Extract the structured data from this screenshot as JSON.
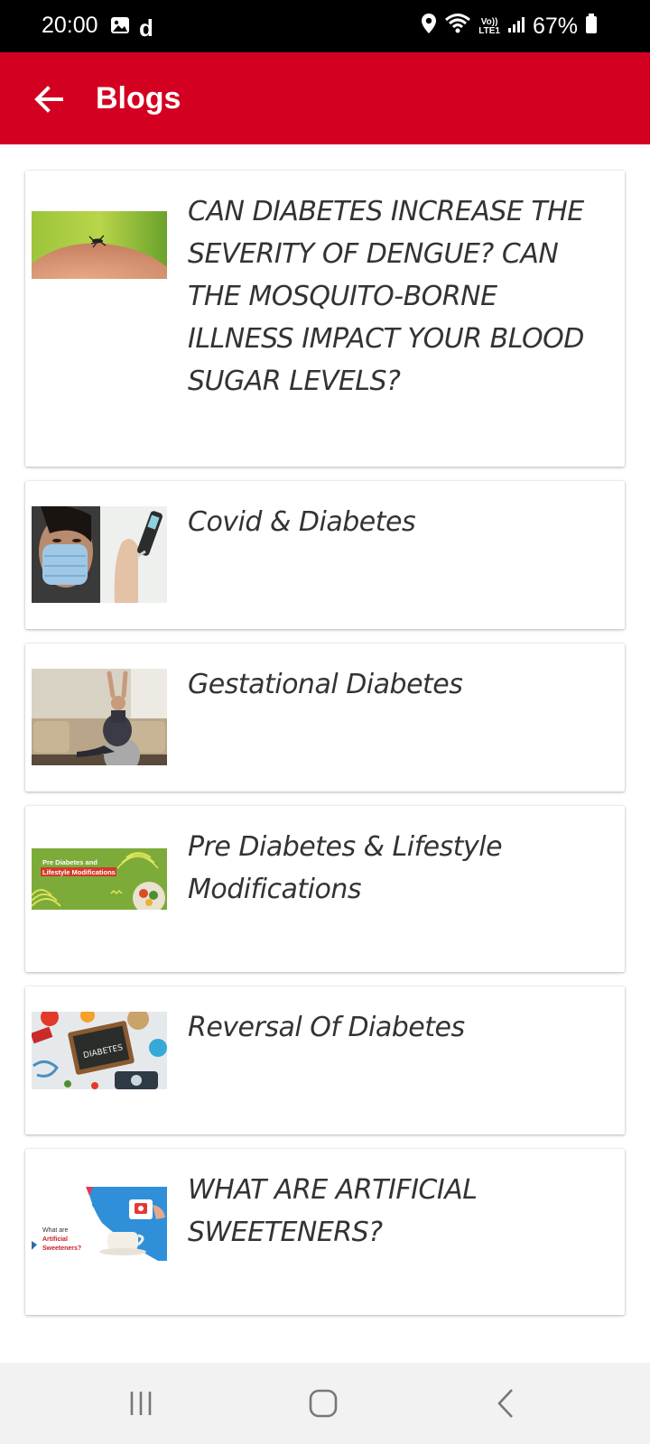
{
  "status_bar": {
    "time": "20:00",
    "carrier_letter": "d",
    "lte_label_top": "Vo))",
    "lte_label_bottom": "LTE1",
    "battery": "67%"
  },
  "app_bar": {
    "title": "Blogs",
    "color": "#d30021"
  },
  "blogs": [
    {
      "title": "CAN DIABETES INCREASE THE SEVERITY OF DENGUE? CAN THE MOSQUITO-BORNE ILLNESS IMPACT YOUR BLOOD SUGAR LEVELS?",
      "thumbnail": "mosquito-on-skin"
    },
    {
      "title": "Covid & Diabetes",
      "thumbnail": "mask-and-glucometer"
    },
    {
      "title": "Gestational Diabetes",
      "thumbnail": "pregnant-woman-exercise"
    },
    {
      "title": "Pre Diabetes & Lifestyle Modifications",
      "thumbnail": "prediabetes-banner",
      "thumb_text_1": "Pre Diabetes and",
      "thumb_text_2": "Lifestyle Modifications"
    },
    {
      "title": "Reversal Of Diabetes",
      "thumbnail": "diabetes-chalkboard",
      "thumb_text": "DIABETES"
    },
    {
      "title": "WHAT ARE ARTIFICIAL SWEETENERS?",
      "thumbnail": "artificial-sweeteners-banner",
      "thumb_text_1": "What are",
      "thumb_text_2": "Artificial",
      "thumb_text_3": "Sweeteners?"
    }
  ]
}
